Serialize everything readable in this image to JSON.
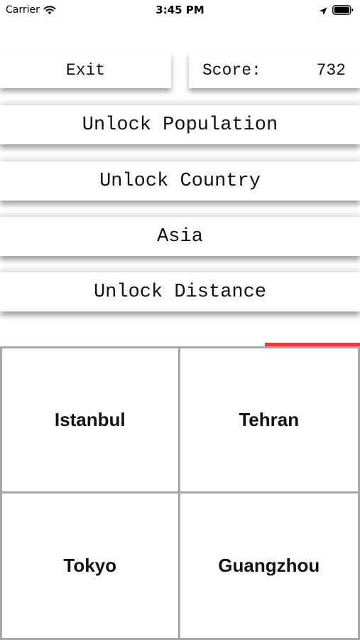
{
  "status_bar": {
    "carrier": "Carrier",
    "time": "3:45 PM"
  },
  "header": {
    "exit_label": "Exit",
    "score_label": "Score:",
    "score_value": "732"
  },
  "options": [
    "Unlock Population",
    "Unlock Country",
    "Asia",
    "Unlock Distance"
  ],
  "timer": {
    "remaining_fraction": 0.265,
    "color": "#e63b3b"
  },
  "answers": [
    "Istanbul",
    "Tehran",
    "Tokyo",
    "Guangzhou"
  ]
}
